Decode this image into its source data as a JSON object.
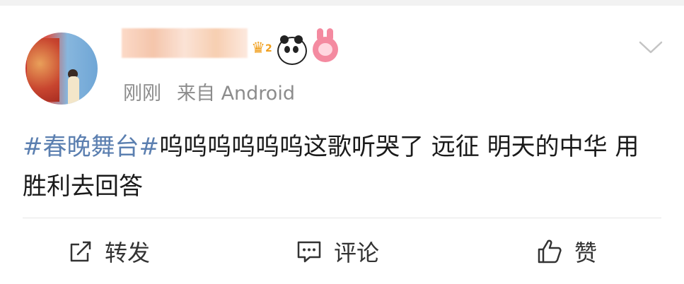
{
  "post": {
    "time": "刚刚",
    "source": "来自 Android",
    "hashtag": "#春晚舞台#",
    "text": "呜呜呜呜呜呜这歌听哭了 远征 明天的中华 用胜利去回答"
  },
  "badges": {
    "vip_level": "2"
  },
  "actions": {
    "repost": "转发",
    "comment": "评论",
    "like": "赞"
  },
  "icons": {
    "more": "chevron-down-icon",
    "repost": "share-edit-icon",
    "comment": "comment-icon",
    "like": "thumbs-up-icon"
  }
}
